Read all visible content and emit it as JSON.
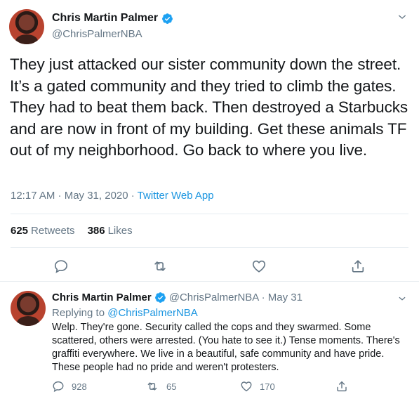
{
  "colors": {
    "text": "#14171a",
    "muted": "#657786",
    "link": "#1b95e0",
    "verified": "#1da1f2",
    "divider": "#e6ecf0"
  },
  "main_tweet": {
    "display_name": "Chris Martin Palmer",
    "handle": "@ChrisPalmerNBA",
    "text": "They just attacked our sister community down the street. It’s a gated community and they tried to climb the gates. They had to beat them back. Then destroyed a Starbucks and are now in front of my building. Get these animals TF out of my neighborhood. Go back to where you live.",
    "timestamp": "12:17 AM · May 31, 2020 · ",
    "source_app": "Twitter Web App",
    "retweets_count": "625",
    "retweets_label": "Retweets",
    "likes_count": "386",
    "likes_label": "Likes",
    "icons": [
      "verified-badge-icon",
      "chevron-down-icon",
      "reply-icon",
      "retweet-icon",
      "like-icon",
      "share-icon"
    ]
  },
  "reply_tweet": {
    "display_name": "Chris Martin Palmer",
    "handle_date": "@ChrisPalmerNBA · May 31",
    "replying_prefix": "Replying to ",
    "replying_to": "@ChrisPalmerNBA",
    "text": "Welp. They're gone. Security called the cops and they swarmed. Some scattered, others were arrested. (You hate to see it.) Tense moments. There's graffiti everywhere. We live in a beautiful, safe community and have pride. These people had no pride and weren't protesters.",
    "reply_count": "928",
    "retweet_count": "65",
    "like_count": "170"
  }
}
